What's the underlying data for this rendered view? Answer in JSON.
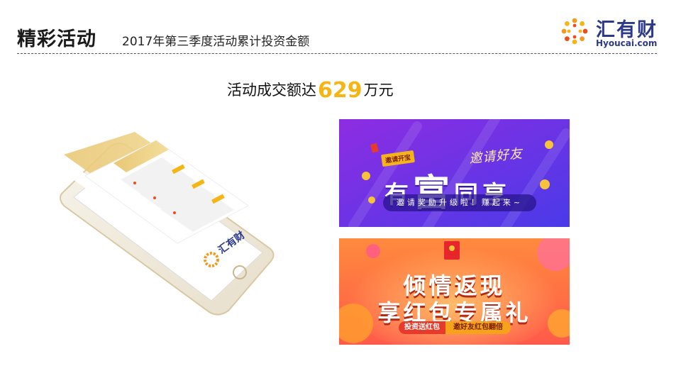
{
  "header": {
    "title": "精彩活动",
    "subtitle": "2017年第三季度活动累计投资金额"
  },
  "logo": {
    "name": "汇有财",
    "domain": "Hyoucai.com"
  },
  "headline": {
    "prefix": "活动成交额达",
    "amount": "629",
    "suffix": "万元"
  },
  "phone": {
    "screen_title": "汇有财"
  },
  "banner_invite": {
    "tag": "邀请开宝",
    "script": "邀请好友",
    "main_pre": "有",
    "main_big": "富",
    "main_post": "同享",
    "pill": "邀请奖励升级啦！赚起来~"
  },
  "banner_cashback": {
    "line1": "倾情返现",
    "line2": "享红包专属礼",
    "button_invest": "投资送红包",
    "button_invite": "邀好友红包翻倍"
  },
  "colors": {
    "accent_gold": "#f5b514",
    "brand_blue": "#2d3a8c",
    "banner_purple": "#6a35e8",
    "banner_orange": "#ff6a3a"
  },
  "icons": [
    "logo-flower-icon",
    "coin-icon",
    "red-envelope-icon"
  ]
}
